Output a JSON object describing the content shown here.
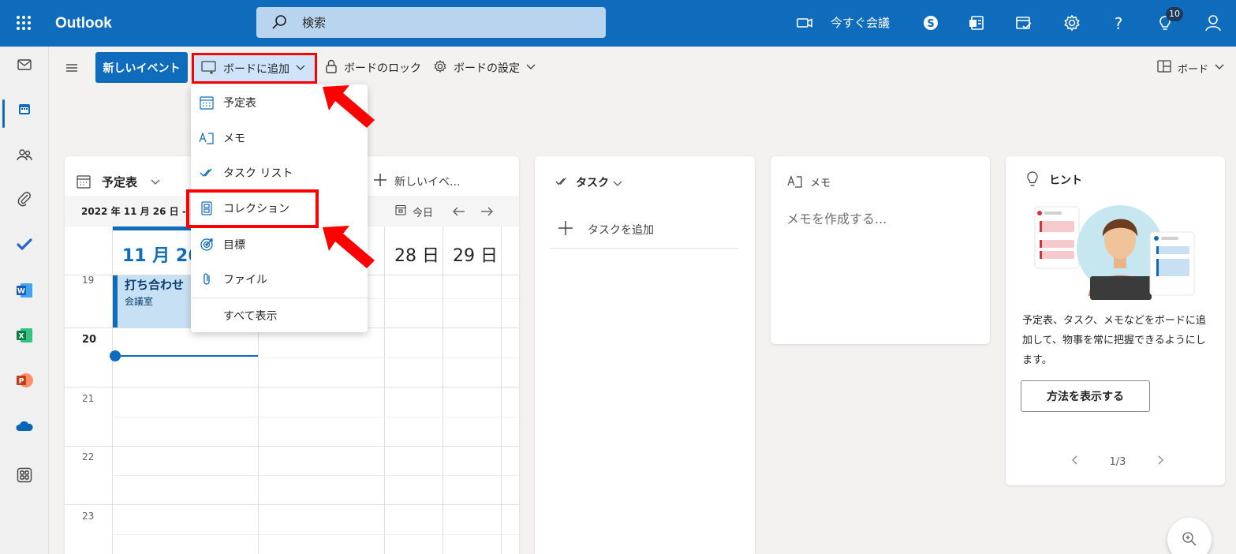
{
  "app": {
    "name": "Outlook"
  },
  "search": {
    "placeholder": "検索"
  },
  "top_bar": {
    "meet_now": "今すぐ会議",
    "notification_count": "10"
  },
  "command_bar": {
    "new_event": "新しいイベント",
    "add_to_board": "ボードに追加",
    "lock_board": "ボードのロック",
    "board_settings": "ボードの設定",
    "view": "ボード"
  },
  "dropdown": {
    "items": [
      {
        "label": "予定表",
        "icon": "calendar-icon"
      },
      {
        "label": "メモ",
        "icon": "note-icon"
      },
      {
        "label": "タスク リスト",
        "icon": "checkmark-icon"
      },
      {
        "label": "コレクション",
        "icon": "collection-icon"
      },
      {
        "label": "目標",
        "icon": "target-icon"
      },
      {
        "label": "ファイル",
        "icon": "attachment-icon"
      },
      {
        "label": "すべて表示",
        "icon": ""
      }
    ]
  },
  "calendar_card": {
    "title": "予定表",
    "new_event": "新しいイベ...",
    "date_label": "2022 年 11 月 26 日 -",
    "today": "今日",
    "days": [
      "11 月 26",
      "28 日",
      "29 日"
    ],
    "hours": [
      "19",
      "20",
      "21",
      "22",
      "23"
    ],
    "event": {
      "title": "打ち合わせ",
      "location": "会議室"
    }
  },
  "task_card": {
    "title": "タスク",
    "add_task": "タスクを追加"
  },
  "memo_card": {
    "title": "メモ",
    "placeholder": "メモを作成する..."
  },
  "hint_card": {
    "title": "ヒント",
    "description": "予定表、タスク、メモなどをボードに追加して、物事を常に把握できるようにします。",
    "button": "方法を表示する",
    "pager": "1/3"
  },
  "colors": {
    "brand": "#0f6cbd",
    "highlight": "#ff0000"
  }
}
